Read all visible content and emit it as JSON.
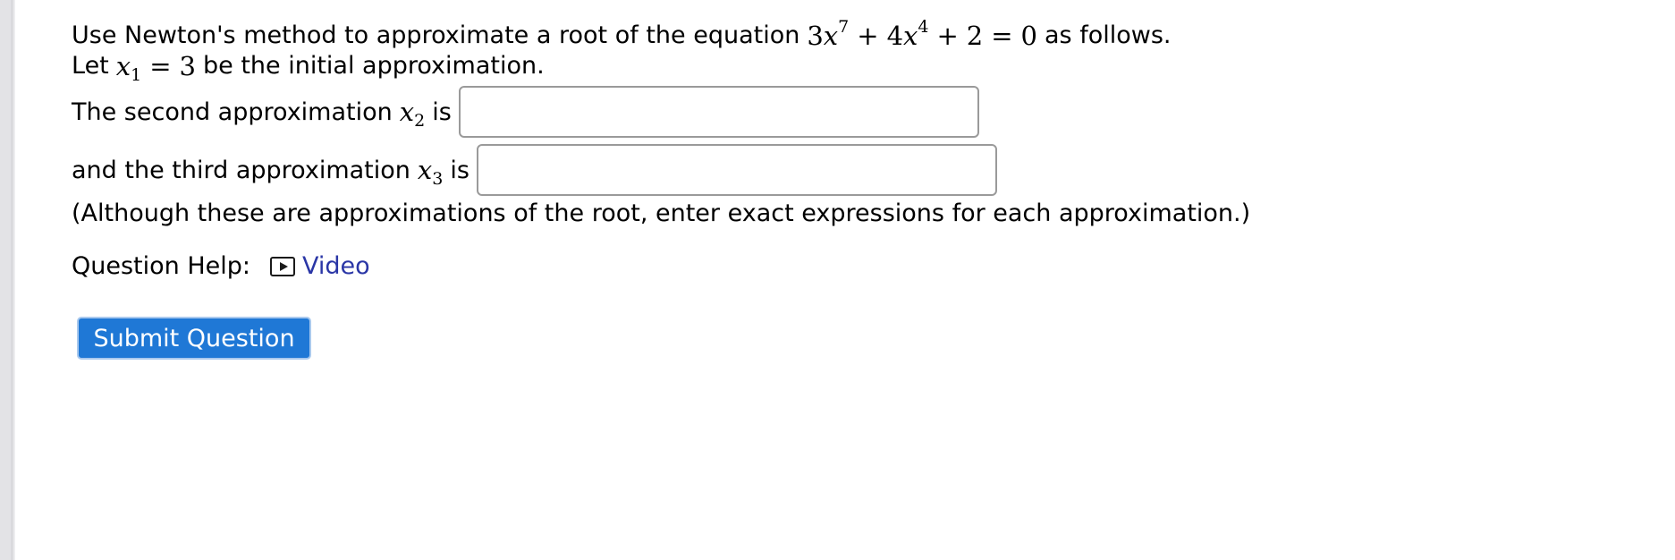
{
  "question": {
    "intro_text": "Use Newton's method to approximate a root of the equation",
    "equation": {
      "coef1": "3",
      "var1": "x",
      "exp1": "7",
      "plus1": "+",
      "coef2": "4",
      "var2": "x",
      "exp2": "4",
      "plus2": "+",
      "const": "2",
      "equals": "=",
      "rhs": "0"
    },
    "intro_suffix": "as follows.",
    "initial_prefix": "Let",
    "initial_var": "x",
    "initial_sub": "1",
    "initial_equals": "=",
    "initial_value": "3",
    "initial_suffix": "be the initial approximation.",
    "second_prefix": "The second approximation",
    "second_var": "x",
    "second_sub": "2",
    "second_suffix": "is",
    "second_value": "",
    "third_prefix": "and the third approximation",
    "third_var": "x",
    "third_sub": "3",
    "third_suffix": "is",
    "third_value": "",
    "note": "(Although these are approximations of the root, enter exact expressions for each approximation.)"
  },
  "help": {
    "label": "Question Help:",
    "video_icon": "play-video-icon",
    "video_label": "Video"
  },
  "submit": {
    "label": "Submit Question"
  },
  "colors": {
    "link": "#2a36a6",
    "button_bg": "#1f78d6",
    "button_text": "#ffffff",
    "input_border": "#9a9a9a"
  }
}
